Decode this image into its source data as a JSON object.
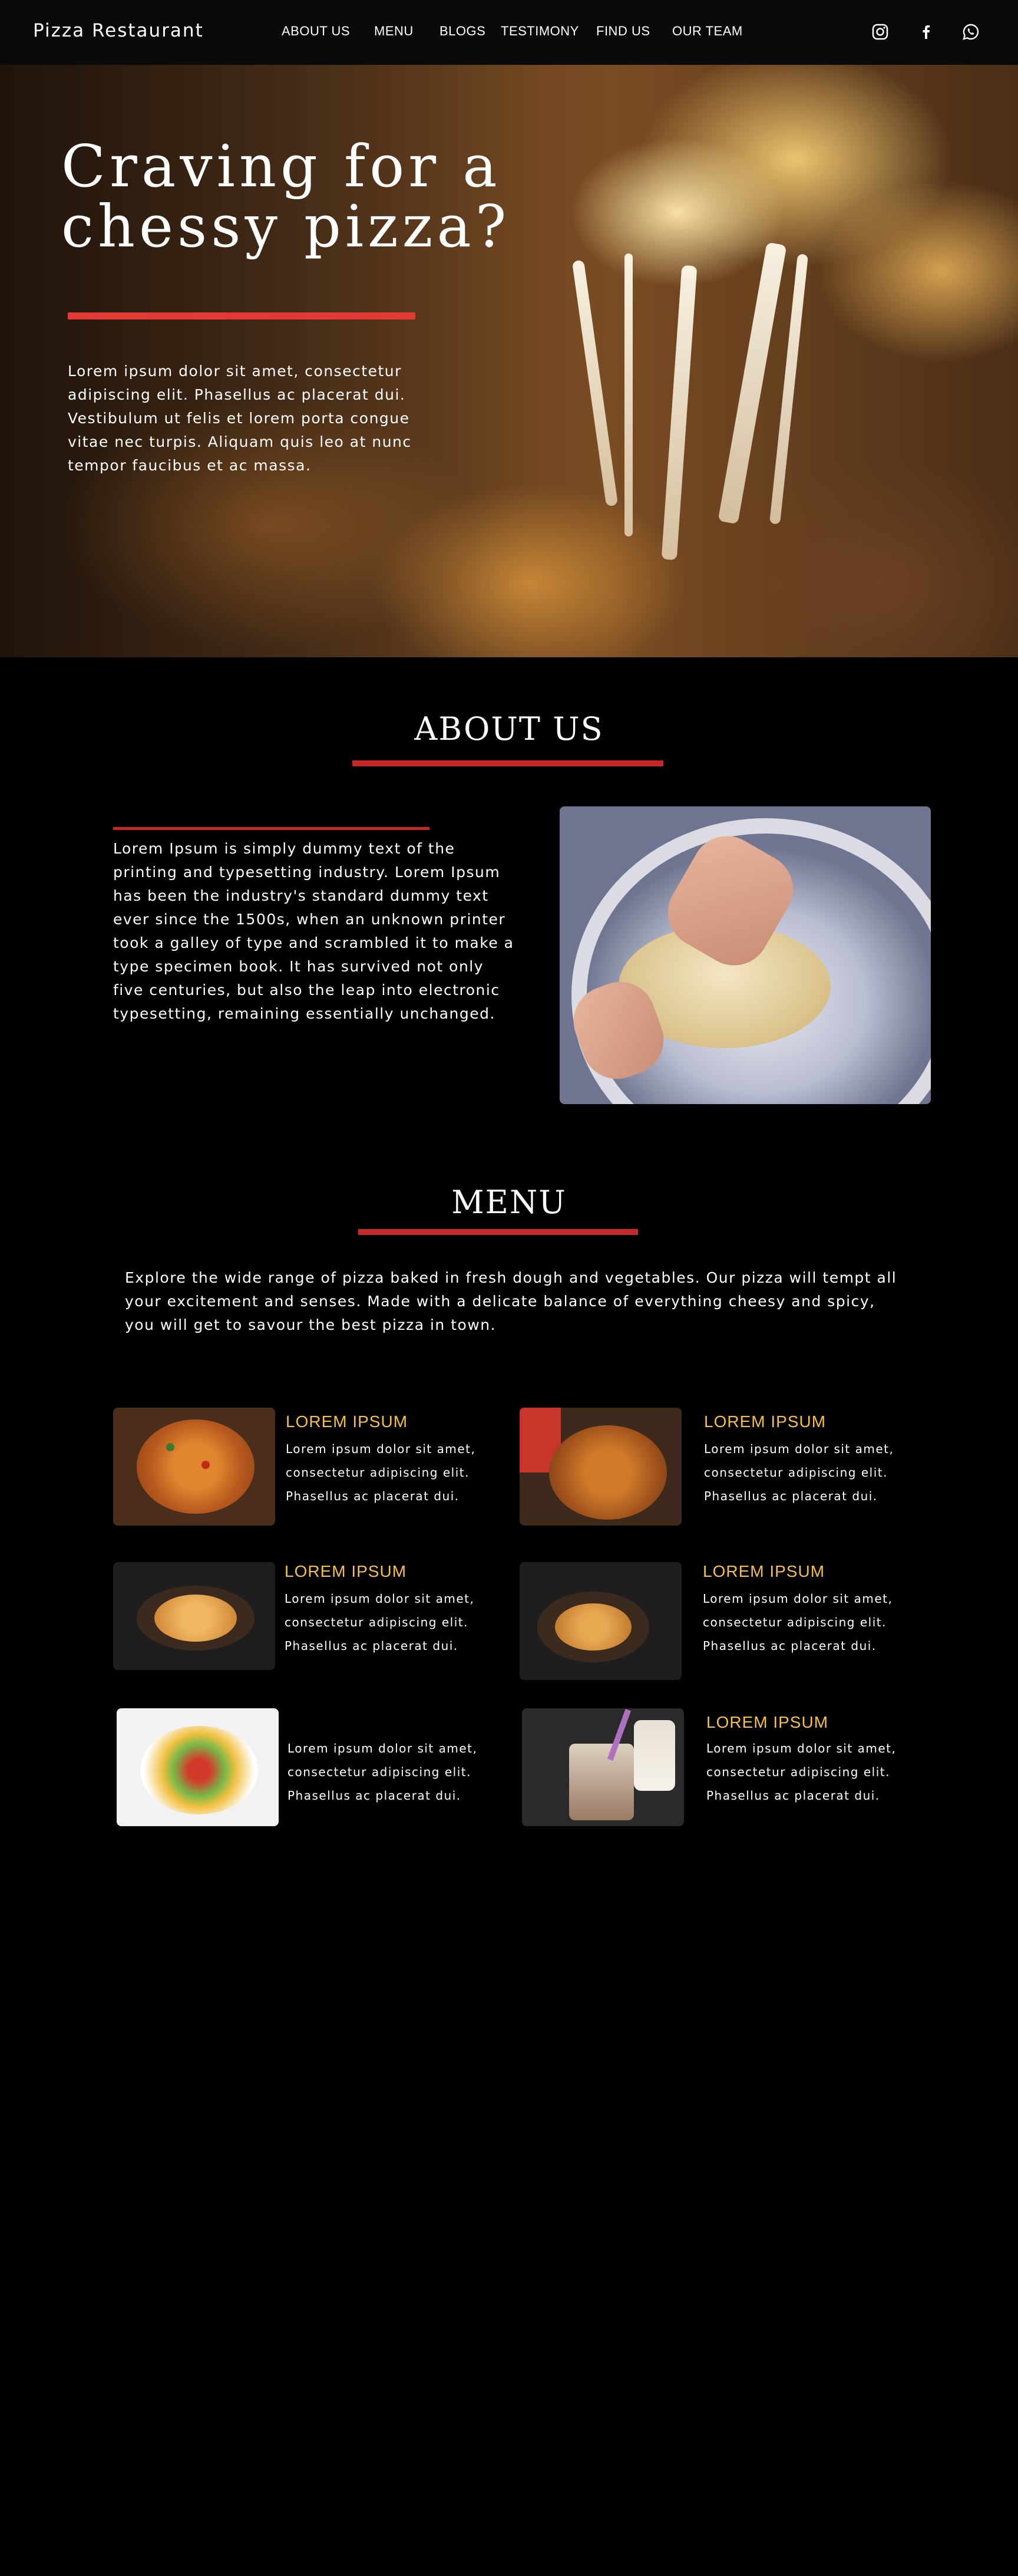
{
  "navbar": {
    "brand": "Pizza Restaurant",
    "links": [
      "ABOUT US",
      "MENU",
      "BLOGS",
      "TESTIMONY",
      "FIND US",
      "OUR TEAM"
    ],
    "social_icons": [
      "instagram-icon",
      "facebook-icon",
      "whatsapp-icon"
    ]
  },
  "hero": {
    "title_line1": "Craving for a",
    "title_line2": "chessy pizza?",
    "text": "Lorem ipsum dolor sit amet, consectetur adipiscing elit. Phasellus ac placerat dui. Vestibulum ut felis et lorem porta congue vitae nec turpis. Aliquam quis leo at nunc tempor faucibus et ac massa."
  },
  "about": {
    "title": "ABOUT US",
    "text": "Lorem Ipsum is simply dummy text of the printing and typesetting industry. Lorem Ipsum has been the industry's standard dummy text ever since the 1500s, when an unknown printer took a galley of type and scrambled it to make a type specimen book. It has survived not only five centuries, but also the leap into electronic typesetting, remaining essentially unchanged."
  },
  "menu": {
    "title": "MENU",
    "intro": "Explore the wide range of pizza baked in fresh dough and vegetables. Our pizza will tempt all your excitement and senses. Made with a delicate balance of everything cheesy and spicy, you will get to savour the best pizza in town.",
    "items": [
      {
        "heading": "LOREM IPSUM",
        "desc": "Lorem ipsum dolor sit amet, consectetur adipiscing elit. Phasellus ac placerat dui."
      },
      {
        "heading": "LOREM IPSUM",
        "desc": "Lorem ipsum dolor sit amet, consectetur adipiscing elit. Phasellus ac placerat dui."
      },
      {
        "heading": "LOREM IPSUM",
        "desc": "Lorem ipsum dolor sit amet, consectetur adipiscing elit. Phasellus ac placerat dui."
      },
      {
        "heading": "LOREM IPSUM",
        "desc": "Lorem ipsum dolor sit amet, consectetur adipiscing elit. Phasellus ac placerat dui."
      },
      {
        "heading": "",
        "desc": "Lorem ipsum dolor sit amet, consectetur adipiscing elit. Phasellus ac placerat dui."
      },
      {
        "heading": "LOREM IPSUM",
        "desc": "Lorem ipsum dolor sit amet, consectetur adipiscing elit. Phasellus ac placerat dui."
      }
    ]
  },
  "colors": {
    "accent_red": "#c62828",
    "hero_rule_red": "#e53935",
    "menu_heading_gold": "#f5c04a",
    "background": "#000000"
  }
}
